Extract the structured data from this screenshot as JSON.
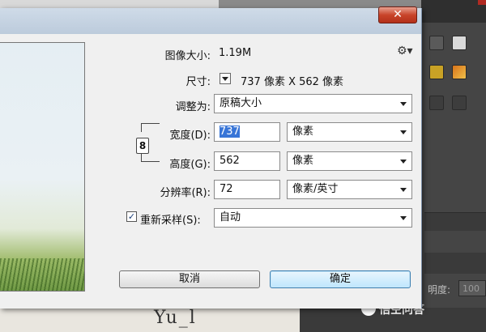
{
  "dialog": {
    "close_glyph": "✕",
    "image_size_label": "图像大小:",
    "image_size_value": "1.19M",
    "dimensions_label": "尺寸:",
    "dimensions_value": "737 像素  X  562 像素",
    "fit_to_label": "调整为:",
    "fit_to_value": "原稿大小",
    "width_label": "宽度(D):",
    "width_value": "737",
    "width_unit": "像素",
    "height_label": "高度(G):",
    "height_value": "562",
    "height_unit": "像素",
    "resolution_label": "分辨率(R):",
    "resolution_value": "72",
    "resolution_unit": "像素/英寸",
    "resample_checked": true,
    "resample_check_glyph": "✓",
    "resample_label": "重新采样(S):",
    "resample_value": "自动",
    "cancel_label": "取消",
    "ok_label": "确定",
    "link_glyph": "8"
  },
  "background": {
    "opacity_label": "明度:",
    "opacity_value": "100",
    "bottom_text": "Yu_l",
    "watermark": "悟空问答"
  },
  "icons": {
    "gear": "gear-icon",
    "link": "link-icon",
    "close": "close-icon"
  },
  "colors": {
    "close_button": "#c8442a",
    "selection": "#3875d7",
    "default_button": "#bee6fd"
  }
}
